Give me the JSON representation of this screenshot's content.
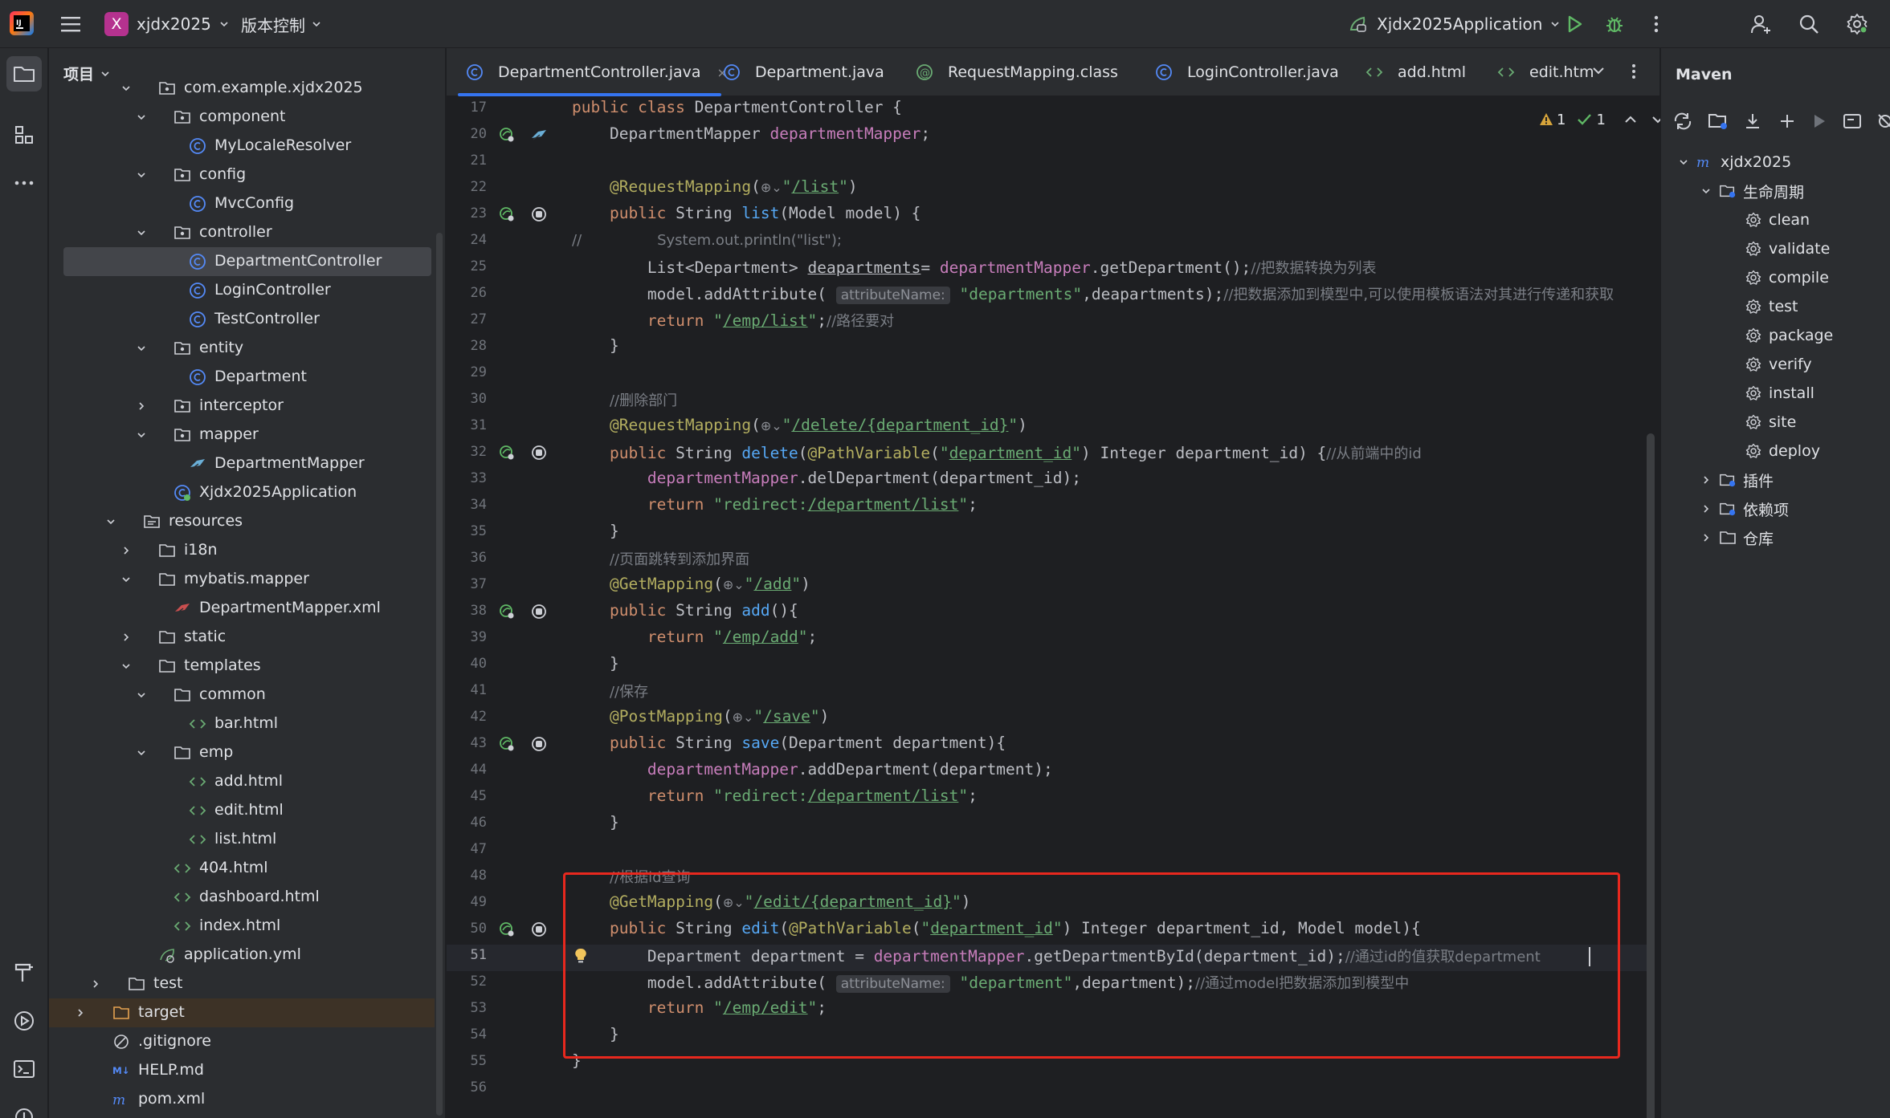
{
  "app": {
    "project_name": "xjdx2025",
    "project_badge": "X",
    "vcs_label": "版本控制",
    "run_config": "Xjdx2025Application"
  },
  "project_panel": {
    "title": "项目",
    "tree": [
      {
        "label": "com.example.xjdx2025",
        "icon": "package-icon",
        "depth": 4,
        "arrow": "down"
      },
      {
        "label": "component",
        "icon": "package-icon",
        "depth": 5,
        "arrow": "down"
      },
      {
        "label": "MyLocaleResolver",
        "icon": "class-icon",
        "depth": 6,
        "arrow": ""
      },
      {
        "label": "config",
        "icon": "package-icon",
        "depth": 5,
        "arrow": "down"
      },
      {
        "label": "MvcConfig",
        "icon": "class-icon",
        "depth": 6,
        "arrow": ""
      },
      {
        "label": "controller",
        "icon": "package-icon",
        "depth": 5,
        "arrow": "down"
      },
      {
        "label": "DepartmentController",
        "icon": "class-icon",
        "depth": 6,
        "arrow": "",
        "selected": true
      },
      {
        "label": "LoginController",
        "icon": "class-icon",
        "depth": 6,
        "arrow": ""
      },
      {
        "label": "TestController",
        "icon": "class-icon",
        "depth": 6,
        "arrow": ""
      },
      {
        "label": "entity",
        "icon": "package-icon",
        "depth": 5,
        "arrow": "down"
      },
      {
        "label": "Department",
        "icon": "class-icon",
        "depth": 6,
        "arrow": ""
      },
      {
        "label": "interceptor",
        "icon": "package-icon",
        "depth": 5,
        "arrow": "right"
      },
      {
        "label": "mapper",
        "icon": "package-icon",
        "depth": 5,
        "arrow": "down"
      },
      {
        "label": "DepartmentMapper",
        "icon": "mybatis-icon",
        "depth": 6,
        "arrow": ""
      },
      {
        "label": "Xjdx2025Application",
        "icon": "spring-class-icon",
        "depth": 5,
        "arrow": ""
      },
      {
        "label": "resources",
        "icon": "resources-folder-icon",
        "depth": 3,
        "arrow": "down"
      },
      {
        "label": "i18n",
        "icon": "folder-icon",
        "depth": 4,
        "arrow": "right"
      },
      {
        "label": "mybatis.mapper",
        "icon": "folder-icon",
        "depth": 4,
        "arrow": "down"
      },
      {
        "label": "DepartmentMapper.xml",
        "icon": "mybatis-xml-icon",
        "depth": 5,
        "arrow": ""
      },
      {
        "label": "static",
        "icon": "folder-icon",
        "depth": 4,
        "arrow": "right"
      },
      {
        "label": "templates",
        "icon": "folder-icon",
        "depth": 4,
        "arrow": "down"
      },
      {
        "label": "common",
        "icon": "folder-icon",
        "depth": 5,
        "arrow": "down"
      },
      {
        "label": "bar.html",
        "icon": "html-icon",
        "depth": 6,
        "arrow": ""
      },
      {
        "label": "emp",
        "icon": "folder-icon",
        "depth": 5,
        "arrow": "down"
      },
      {
        "label": "add.html",
        "icon": "html-icon",
        "depth": 6,
        "arrow": ""
      },
      {
        "label": "edit.html",
        "icon": "html-icon",
        "depth": 6,
        "arrow": ""
      },
      {
        "label": "list.html",
        "icon": "html-icon",
        "depth": 6,
        "arrow": ""
      },
      {
        "label": "404.html",
        "icon": "html-icon",
        "depth": 5,
        "arrow": ""
      },
      {
        "label": "dashboard.html",
        "icon": "html-icon",
        "depth": 5,
        "arrow": ""
      },
      {
        "label": "index.html",
        "icon": "html-icon",
        "depth": 5,
        "arrow": ""
      },
      {
        "label": "application.yml",
        "icon": "yaml-icon",
        "depth": 4,
        "arrow": ""
      },
      {
        "label": "test",
        "icon": "folder-icon",
        "depth": 2,
        "arrow": "right"
      },
      {
        "label": "target",
        "icon": "target-folder-icon",
        "depth": 1,
        "arrow": "right",
        "target": true
      },
      {
        "label": ".gitignore",
        "icon": "gitignore-icon",
        "depth": 1,
        "arrow": ""
      },
      {
        "label": "HELP.md",
        "icon": "markdown-icon",
        "depth": 1,
        "arrow": ""
      },
      {
        "label": "pom.xml",
        "icon": "maven-icon",
        "depth": 1,
        "arrow": ""
      }
    ]
  },
  "tabs": [
    {
      "label": "DepartmentController.java",
      "icon": "class-icon",
      "active": true,
      "close": "×"
    },
    {
      "label": "Department.java",
      "icon": "class-icon",
      "active": false
    },
    {
      "label": "RequestMapping.class",
      "icon": "annotation-icon",
      "active": false
    },
    {
      "label": "LoginController.java",
      "icon": "class-icon",
      "active": false
    },
    {
      "label": "add.html",
      "icon": "html-icon",
      "active": false
    },
    {
      "label": "edit.htm",
      "icon": "html-icon",
      "active": false
    }
  ],
  "inspections": {
    "warnings": "1",
    "ok": "1"
  },
  "code_lines": [
    {
      "n": "17",
      "html": "<span class='kw'>public class</span> DepartmentController {"
    },
    {
      "n": "20",
      "html": "    DepartmentMapper <span class='fld'>departmentMapper</span>;"
    },
    {
      "n": "21",
      "html": ""
    },
    {
      "n": "22",
      "html": "    <span class='ann'>@RequestMapping</span>(<span class='globe'>⊕⌄</span><span class='str'>\"</span><span class='url'>/list</span><span class='str'>\"</span>)"
    },
    {
      "n": "23",
      "html": "    <span class='kw'>public</span> String <span class='mth'>list</span>(Model model) {"
    },
    {
      "n": "24",
      "html": "<span class='cm'>//</span>        <span class='cm'>System.out.println(\"list\");</span>"
    },
    {
      "n": "25",
      "html": "        List&lt;Department&gt; <span style='text-decoration:underline'>deapartments</span>= <span class='fld'>departmentMapper</span>.getDepartment();<span class='cm'>//把数据转换为列表</span>"
    },
    {
      "n": "26",
      "html": "        model.addAttribute( <span class='hint'>attributeName:</span> <span class='str'>\"departments\"</span>,deapartments);<span class='cm'>//把数据添加到模型中,可以使用模板语法对其进行传递和获取</span>"
    },
    {
      "n": "27",
      "html": "        <span class='kw'>return</span> <span class='str'>\"</span><span class='url'>/emp/list</span><span class='str'>\"</span>;<span class='cm'>//路径要对</span>"
    },
    {
      "n": "28",
      "html": "    }"
    },
    {
      "n": "29",
      "html": ""
    },
    {
      "n": "30",
      "html": "    <span class='cm'>//删除部门</span>"
    },
    {
      "n": "31",
      "html": "    <span class='ann'>@RequestMapping</span>(<span class='globe'>⊕⌄</span><span class='str'>\"</span><span class='url'>/delete/{department_id}</span><span class='str'>\"</span>)"
    },
    {
      "n": "32",
      "html": "    <span class='kw'>public</span> String <span class='mth'>delete</span>(<span class='ann'>@PathVariable</span>(<span class='str'>\"</span><span class='url'>department_id</span><span class='str'>\"</span>) Integer department_id) {<span class='cm'>//从前端中的id</span>"
    },
    {
      "n": "33",
      "html": "        <span class='fld'>departmentMapper</span>.delDepartment(department_id);"
    },
    {
      "n": "34",
      "html": "        <span class='kw'>return</span> <span class='str'>\"redirect:</span><span class='url'>/department/list</span><span class='str'>\"</span>;"
    },
    {
      "n": "35",
      "html": "    }"
    },
    {
      "n": "36",
      "html": "    <span class='cm'>//页面跳转到添加界面</span>"
    },
    {
      "n": "37",
      "html": "    <span class='ann'>@GetMapping</span>(<span class='globe'>⊕⌄</span><span class='str'>\"</span><span class='url'>/add</span><span class='str'>\"</span>)"
    },
    {
      "n": "38",
      "html": "    <span class='kw'>public</span> String <span class='mth'>add</span>(){"
    },
    {
      "n": "39",
      "html": "        <span class='kw'>return</span> <span class='str'>\"</span><span class='url'>/emp/add</span><span class='str'>\"</span>;"
    },
    {
      "n": "40",
      "html": "    }"
    },
    {
      "n": "41",
      "html": "    <span class='cm'>//保存</span>"
    },
    {
      "n": "42",
      "html": "    <span class='ann'>@PostMapping</span>(<span class='globe'>⊕⌄</span><span class='str'>\"</span><span class='url'>/save</span><span class='str'>\"</span>)"
    },
    {
      "n": "43",
      "html": "    <span class='kw'>public</span> String <span class='mth'>save</span>(Department department){"
    },
    {
      "n": "44",
      "html": "        <span class='fld'>departmentMapper</span>.addDepartment(department);"
    },
    {
      "n": "45",
      "html": "        <span class='kw'>return</span> <span class='str'>\"redirect:</span><span class='url'>/department/list</span><span class='str'>\"</span>;"
    },
    {
      "n": "46",
      "html": "    }"
    },
    {
      "n": "47",
      "html": ""
    },
    {
      "n": "48",
      "html": "    <span class='cm'>//根据id查询</span>"
    },
    {
      "n": "49",
      "html": "    <span class='ann'>@GetMapping</span>(<span class='globe'>⊕⌄</span><span class='str'>\"</span><span class='url'>/edit/{department_id}</span><span class='str'>\"</span>)"
    },
    {
      "n": "50",
      "html": "    <span class='kw'>public</span> String <span class='mth'>edit</span>(<span class='ann'>@PathVariable</span>(<span class='str'>\"</span><span class='url'>department_id</span><span class='str'>\"</span>) Integer department_id, Model model){"
    },
    {
      "n": "51",
      "html": "        Department department = <span class='fld'>departmentMapper</span>.getDepartmentById(department_id);<span class='cm'>//通过id的值获取department</span>"
    },
    {
      "n": "52",
      "html": "        model.addAttribute( <span class='hint'>attributeName:</span> <span class='str'>\"department\"</span>,department);<span class='cm'>//通过model把数据添加到模型中</span>"
    },
    {
      "n": "53",
      "html": "        <span class='kw'>return</span> <span class='str'>\"</span><span class='url'>/emp/edit</span><span class='str'>\"</span>;"
    },
    {
      "n": "54",
      "html": "    }"
    },
    {
      "n": "55",
      "html": "}"
    },
    {
      "n": "56",
      "html": ""
    }
  ],
  "maven": {
    "title": "Maven",
    "project": "xjdx2025",
    "lifecycle": "生命周期",
    "phases": [
      "clean",
      "validate",
      "compile",
      "test",
      "package",
      "verify",
      "install",
      "site",
      "deploy"
    ],
    "groups": [
      "插件",
      "依赖项",
      "仓库"
    ]
  },
  "colors": {
    "accent": "#3574f0",
    "highlight_box": "#e8281e",
    "run_green": "#5fb865",
    "badge": "#b5328f"
  }
}
